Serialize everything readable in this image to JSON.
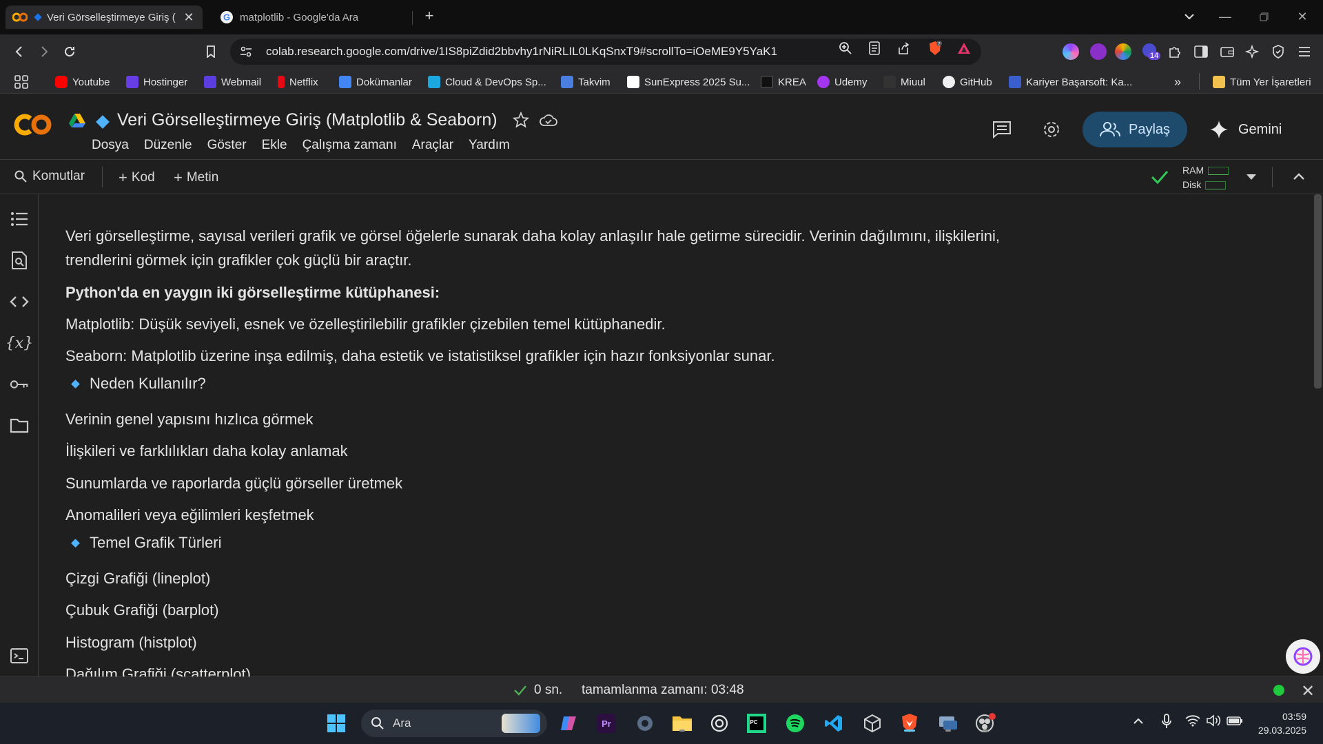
{
  "browser": {
    "tabs": [
      {
        "title": "Veri Görselleştirmeye Giriş (",
        "active": true
      },
      {
        "title": "matplotlib - Google'da Ara",
        "active": false
      }
    ],
    "url": "colab.research.google.com/drive/1IS8piZdid2bbvhy1rNiRLIL0LKqSnxT9#scrollTo=iOeME9Y5YaK1",
    "extension_badge": "14",
    "bookmarks": [
      {
        "label": "Youtube",
        "color": "#ff0000"
      },
      {
        "label": "Hostinger",
        "color": "#673de6"
      },
      {
        "label": "Webmail",
        "color": "#5b3de0"
      },
      {
        "label": "Netflix",
        "color": "#e50914"
      },
      {
        "label": "Dokümanlar",
        "color": "#4285f4"
      },
      {
        "label": "Cloud & DevOps Sp...",
        "color": "#1ba8e0"
      },
      {
        "label": "Takvim",
        "color": "#4a7ee0"
      },
      {
        "label": "SunExpress 2025 Su...",
        "color": "#ffffff"
      },
      {
        "label": "KREA",
        "color": "#111111"
      },
      {
        "label": "Udemy",
        "color": "#a435f0"
      },
      {
        "label": "Miuul",
        "color": "#333333"
      },
      {
        "label": "GitHub",
        "color": "#f0f0f0"
      },
      {
        "label": "Kariyer Başarsoft: Ka...",
        "color": "#3a5fcd"
      }
    ],
    "all_bookmarks": "Tüm Yer İşaretleri"
  },
  "colab": {
    "title": "Veri Görselleştirmeye Giriş (Matplotlib & Seaborn)",
    "menu": [
      "Dosya",
      "Düzenle",
      "Göster",
      "Ekle",
      "Çalışma zamanı",
      "Araçlar",
      "Yardım"
    ],
    "share_label": "Paylaş",
    "gemini_label": "Gemini",
    "toolbar": {
      "commands": "Komutlar",
      "add_code": "Kod",
      "add_text": "Metin",
      "ram": "RAM",
      "disk": "Disk"
    },
    "accent": "#4fb3ff"
  },
  "notebook": {
    "intro_line1": "Veri görselleştirme, sayısal verileri grafik ve görsel öğelerle sunarak daha kolay anlaşılır hale getirme sürecidir. Verinin dağılımını, ilişkilerini,",
    "intro_line2": "trendlerini görmek için grafikler çok güçlü bir araçtır.",
    "libs_heading": "Python'da en yaygın iki görselleştirme kütüphanesi:",
    "matplotlib": "Matplotlib: Düşük seviyeli, esnek ve özelleştirilebilir grafikler çizebilen temel kütüphanedir.",
    "seaborn": "Seaborn: Matplotlib üzerine inşa edilmiş, daha estetik ve istatistiksel grafikler için hazır fonksiyonlar sunar.",
    "why_heading": "Neden Kullanılır?",
    "why_items": [
      "Verinin genel yapısını hızlıca görmek",
      "İlişkileri ve farklılıkları daha kolay anlamak",
      "Sunumlarda ve raporlarda güçlü görseller üretmek",
      "Anomalileri veya eğilimleri keşfetmek"
    ],
    "types_heading": "Temel Grafik Türleri",
    "types_items": [
      "Çizgi Grafiği (lineplot)",
      "Çubuk Grafiği (barplot)",
      "Histogram (histplot)",
      "Dağılım Grafiği (scatterplot)"
    ]
  },
  "status": {
    "elapsed": "0 sn.",
    "completed": "tamamlanma zamanı: 03:48"
  },
  "taskbar": {
    "search": "Ara",
    "time": "03:59",
    "date": "29.03.2025"
  }
}
